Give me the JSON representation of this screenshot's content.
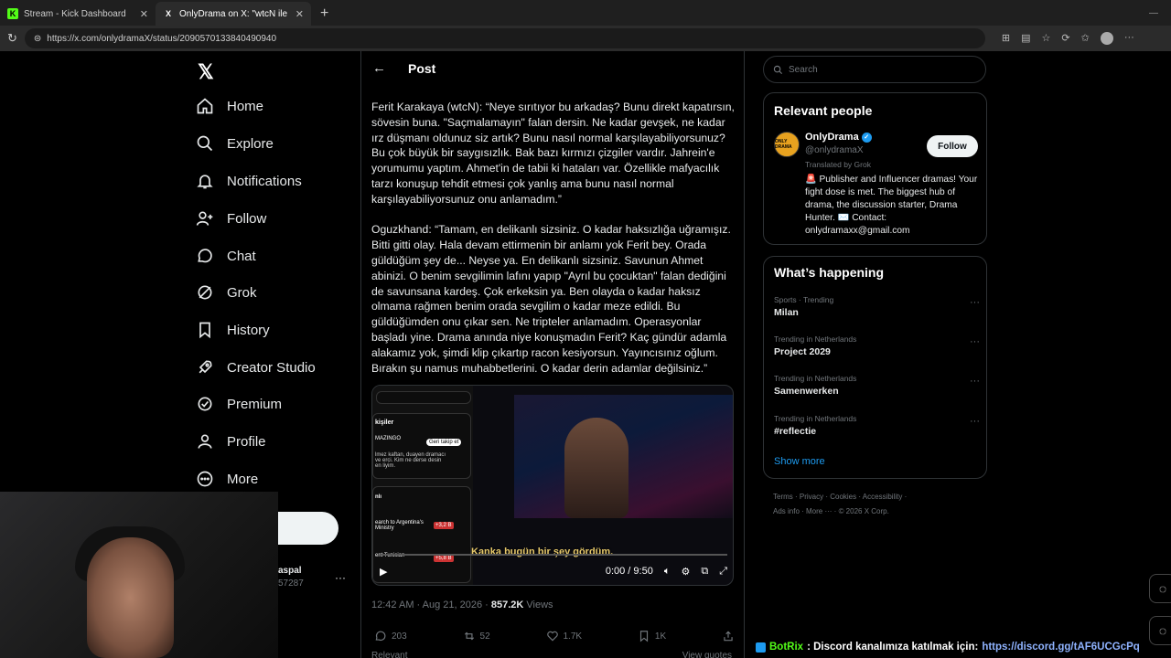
{
  "browser": {
    "tabs": [
      {
        "title": "Stream - Kick Dashboard",
        "favicon": "K",
        "color": "#53fc18",
        "active": false
      },
      {
        "title": "OnlyDrama on X: \"wtcN ile Oguz",
        "favicon": "X",
        "color": "#000000",
        "active": true
      }
    ],
    "url": "https://x.com/onlydramaX/status/2090570133840490940"
  },
  "nav": {
    "items": [
      {
        "label": "Home",
        "icon": "home-icon"
      },
      {
        "label": "Explore",
        "icon": "search-icon"
      },
      {
        "label": "Notifications",
        "icon": "bell-icon"
      },
      {
        "label": "Follow",
        "icon": "person-plus-icon"
      },
      {
        "label": "Chat",
        "icon": "chat-icon"
      },
      {
        "label": "Grok",
        "icon": "grok-icon"
      },
      {
        "label": "History",
        "icon": "bookmark-icon"
      },
      {
        "label": "Creator Studio",
        "icon": "rocket-icon"
      },
      {
        "label": "Premium",
        "icon": "check-badge-icon"
      },
      {
        "label": "Profile",
        "icon": "person-icon"
      },
      {
        "label": "More",
        "icon": "more-circle-icon"
      }
    ],
    "account_name": "aspal",
    "account_handle": "57287"
  },
  "post": {
    "header_title": "Post",
    "text": "Ferit Karakaya (wtcN): “Neye sırıtıyor bu arkadaş? Bunu direkt kapatırsın, sövesin buna. \"Saçmalamayın\" falan dersin. Ne kadar gevşek, ne kadar ırz düşmanı oldunuz siz artık? Bunu nasıl normal karşılayabiliyorsunuz? Bu çok büyük bir saygısızlık. Bak bazı kırmızı çizgiler vardır. Jahrein'e yorumumu yaptım. Ahmet'in de tabii ki hataları var. Özellikle mafyacılık tarzı konuşup tehdit etmesi çok yanlış ama bunu nasıl normal karşılayabiliyorsunuz onu anlamadım.”\n\nOguzkhand: “Tamam, en delikanlı sizsiniz. O kadar haksızlığa uğramışız. Bitti gitti olay. Hala devam ettirmenin bir anlamı yok Ferit bey. Orada güldüğüm şey de... Neyse ya. En delikanlı sizsiniz. Savunun Ahmet abinizi. O benim sevgilimin lafını yapıp \"Ayrıl bu çocuktan\" falan dediğini de savunsana kardeş. Çok erkeksin ya. Ben olayda o kadar haksız olmama rağmen benim orada sevgilim o kadar meze edildi. Bu güldüğümden onu çıkar sen. Ne tripteler anlamadım. Operasyonlar başladı yine. Drama anında niye konuşmadın Ferit? Kaç gündür adamla alakamız yok, şimdi klip çıkartıp racon kesiyorsun. Yayıncısınız oğlum. Bırakın şu namus muhabbetlerini. O kadar derin adamlar değilsiniz.”",
    "video": {
      "subtitle": "Kanka bugün bir şey gördüm.",
      "time": "0:00 / 9:50",
      "panel_title": "kişiler",
      "panel_name": "MAZINGO",
      "panel_button": "Geri takip et",
      "panel_bio": "lmez kaftan, duayen dramacı ve erci. Kim ne derse desin en liyim.",
      "panel_section": "nlı",
      "panel_item1": "earch to Argentina's Ministry",
      "panel_item2": "ent Tunisian",
      "badge1": "+3,2 B",
      "badge2": "+5,8 B",
      "progress": 0
    },
    "timestamp": "12:42 AM · Aug 21, 2026 · ",
    "views_count": "857.2K",
    "views_label": " Views",
    "replies": "203",
    "reposts": "52",
    "likes": "1.7K",
    "bookmarks": "1K",
    "relevant_label": "Relevant",
    "view_quotes": "View quotes"
  },
  "sidebar": {
    "search_placeholder": "Search",
    "relevant_title": "Relevant people",
    "person": {
      "name": "OnlyDrama",
      "handle": "@onlydramaX",
      "translated": "Translated by Grok",
      "bio": "🚨 Publisher and Influencer dramas! Your fight dose is met. The biggest hub of drama, the discussion starter, Drama Hunter. ✉️ Contact: onlydramaxx@gmail.com",
      "follow_label": "Follow",
      "avatar_text": "ONLY DRAMA"
    },
    "happening_title": "What’s happening",
    "trends": [
      {
        "category": "Sports · Trending",
        "name": "Milan"
      },
      {
        "category": "Trending in Netherlands",
        "name": "Project 2029"
      },
      {
        "category": "Trending in Netherlands",
        "name": "Samenwerken"
      },
      {
        "category": "Trending in Netherlands",
        "name": "#reflectie"
      }
    ],
    "show_more": "Show more",
    "footer_line1": "Terms  ·  Privacy  ·  Cookies  ·  Accessibility  ·",
    "footer_line2": "Ads info  ·  More ···  ·  © 2026 X Corp."
  },
  "stream_overlay": {
    "bot_name": "BotRix",
    "message": ": Discord kanalımıza katılmak için: ",
    "link": "https://discord.gg/tAF6UCGcPq"
  }
}
